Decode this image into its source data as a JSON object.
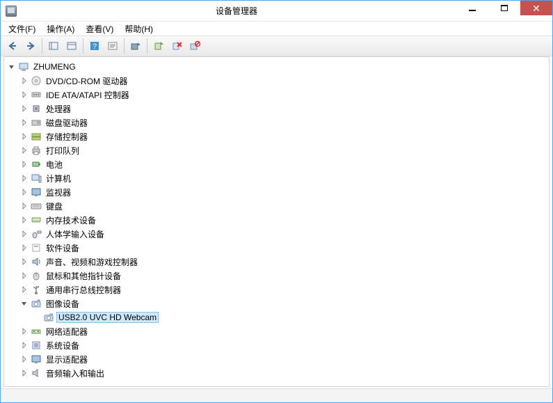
{
  "window": {
    "title": "设备管理器"
  },
  "menus": [
    "文件(F)",
    "操作(A)",
    "查看(V)",
    "帮助(H)"
  ],
  "tree": {
    "label": "ZHUMENG",
    "icon": "computer-icon",
    "expanded": true,
    "children": [
      {
        "label": "DVD/CD-ROM 驱动器",
        "icon": "disc-icon",
        "expandable": true
      },
      {
        "label": "IDE ATA/ATAPI 控制器",
        "icon": "ide-icon",
        "expandable": true
      },
      {
        "label": "处理器",
        "icon": "cpu-icon",
        "expandable": true
      },
      {
        "label": "磁盘驱动器",
        "icon": "disk-icon",
        "expandable": true
      },
      {
        "label": "存储控制器",
        "icon": "storage-icon",
        "expandable": true
      },
      {
        "label": "打印队列",
        "icon": "printer-icon",
        "expandable": true
      },
      {
        "label": "电池",
        "icon": "battery-icon",
        "expandable": true
      },
      {
        "label": "计算机",
        "icon": "pc-icon",
        "expandable": true
      },
      {
        "label": "监视器",
        "icon": "monitor-icon",
        "expandable": true
      },
      {
        "label": "键盘",
        "icon": "keyboard-icon",
        "expandable": true
      },
      {
        "label": "内存技术设备",
        "icon": "memory-icon",
        "expandable": true
      },
      {
        "label": "人体学输入设备",
        "icon": "hid-icon",
        "expandable": true
      },
      {
        "label": "软件设备",
        "icon": "software-icon",
        "expandable": true
      },
      {
        "label": "声音、视频和游戏控制器",
        "icon": "sound-icon",
        "expandable": true
      },
      {
        "label": "鼠标和其他指针设备",
        "icon": "mouse-icon",
        "expandable": true
      },
      {
        "label": "通用串行总线控制器",
        "icon": "usb-icon",
        "expandable": true
      },
      {
        "label": "图像设备",
        "icon": "imaging-icon",
        "expandable": true,
        "expanded": true,
        "children": [
          {
            "label": "USB2.0 UVC HD Webcam",
            "icon": "camera-icon",
            "selected": true
          }
        ]
      },
      {
        "label": "网络适配器",
        "icon": "network-icon",
        "expandable": true
      },
      {
        "label": "系统设备",
        "icon": "system-icon",
        "expandable": true
      },
      {
        "label": "显示适配器",
        "icon": "display-icon",
        "expandable": true
      },
      {
        "label": "音频输入和输出",
        "icon": "audio-icon",
        "expandable": true
      }
    ]
  }
}
